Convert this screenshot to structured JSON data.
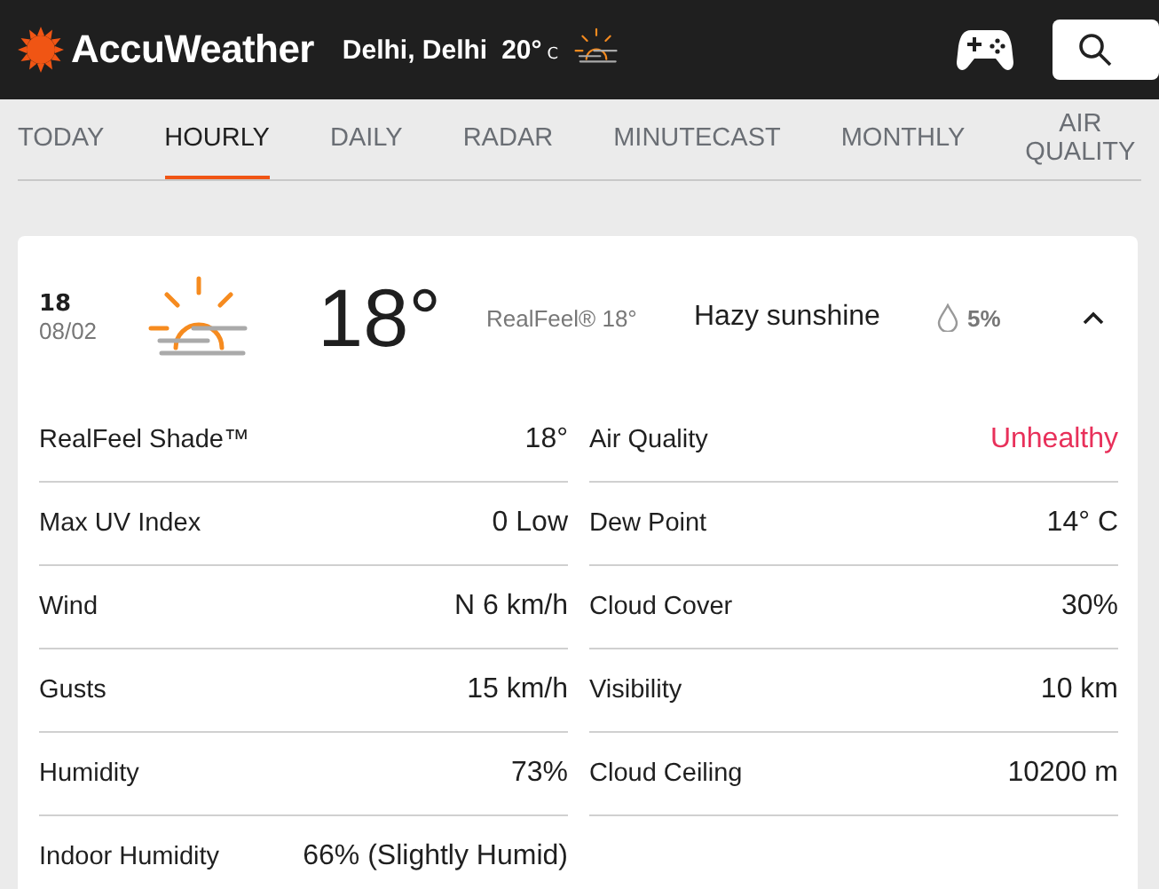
{
  "header": {
    "brand": "AccuWeather",
    "location": "Delhi, Delhi",
    "temperature": "20°",
    "unit": "C"
  },
  "tabs": [
    {
      "label": "TODAY",
      "selected": false
    },
    {
      "label": "HOURLY",
      "selected": true
    },
    {
      "label": "DAILY",
      "selected": false
    },
    {
      "label": "RADAR",
      "selected": false
    },
    {
      "label": "MINUTECAST",
      "selected": false
    },
    {
      "label": "MONTHLY",
      "selected": false
    },
    {
      "label": "AIR QUALITY",
      "selected": false
    }
  ],
  "hour": {
    "time": "18",
    "date": "08/02",
    "temperature": "18°",
    "realfeel": "RealFeel® 18°",
    "condition": "Hazy sunshine",
    "precipitation": "5%",
    "expanded": true
  },
  "details": [
    {
      "label": "RealFeel Shade™",
      "value": "18°",
      "alert": false
    },
    {
      "label": "Air Quality",
      "value": "Unhealthy",
      "alert": true
    },
    {
      "label": "Max UV Index",
      "value": "0 Low",
      "alert": false
    },
    {
      "label": "Dew Point",
      "value": "14° C",
      "alert": false
    },
    {
      "label": "Wind",
      "value": "N 6 km/h",
      "alert": false
    },
    {
      "label": "Cloud Cover",
      "value": "30%",
      "alert": false
    },
    {
      "label": "Gusts",
      "value": "15 km/h",
      "alert": false
    },
    {
      "label": "Visibility",
      "value": "10 km",
      "alert": false
    },
    {
      "label": "Humidity",
      "value": "73%",
      "alert": false
    },
    {
      "label": "Cloud Ceiling",
      "value": "10200 m",
      "alert": false
    },
    {
      "label": "Indoor Humidity",
      "value": "66% (Slightly Humid)",
      "alert": false
    }
  ]
}
